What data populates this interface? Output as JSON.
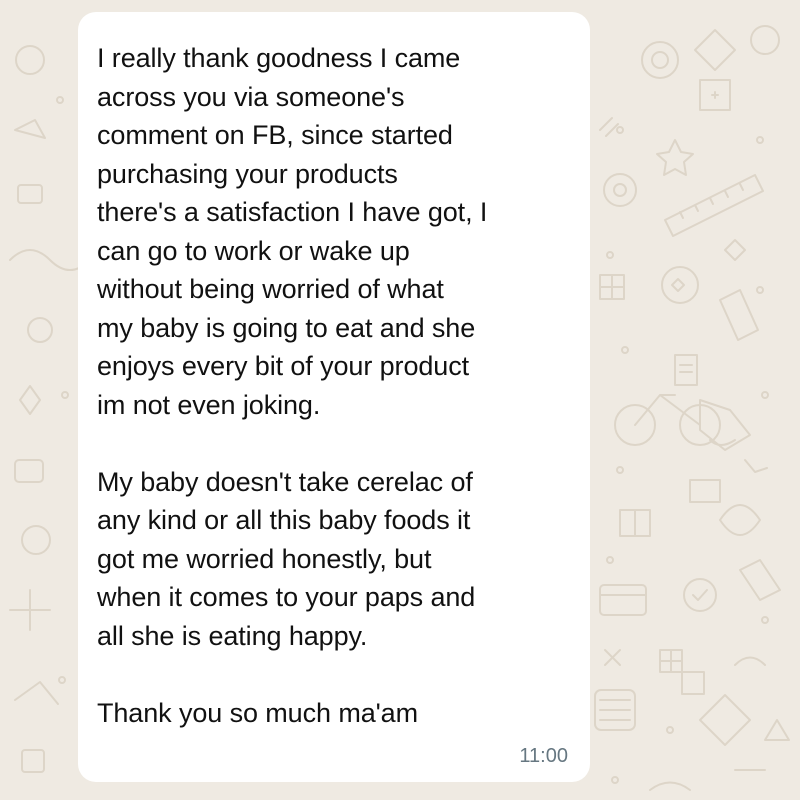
{
  "chat": {
    "message": {
      "paragraph_1": "I really thank goodness I came\nacross you via someone's\ncomment on FB, since started\npurchasing your products\nthere's a satisfaction I have got, I\ncan go to work or wake up\nwithout being worried of what\nmy baby is going to eat and she\nenjoys every bit of your product\nim not even joking.",
      "paragraph_2": "My baby doesn't take cerelac of\nany kind or all this baby foods it\ngot me worried honestly, but\nwhen it comes to your paps and\nall she is eating happy.",
      "paragraph_3": "Thank you so much ma'am",
      "time": "11:00"
    }
  },
  "colors": {
    "wallpaper": "#efeae2",
    "bubble": "#ffffff",
    "text": "#111111",
    "timestamp": "#667781"
  },
  "icons": [
    "chat-wallpaper-doodle-pattern"
  ]
}
